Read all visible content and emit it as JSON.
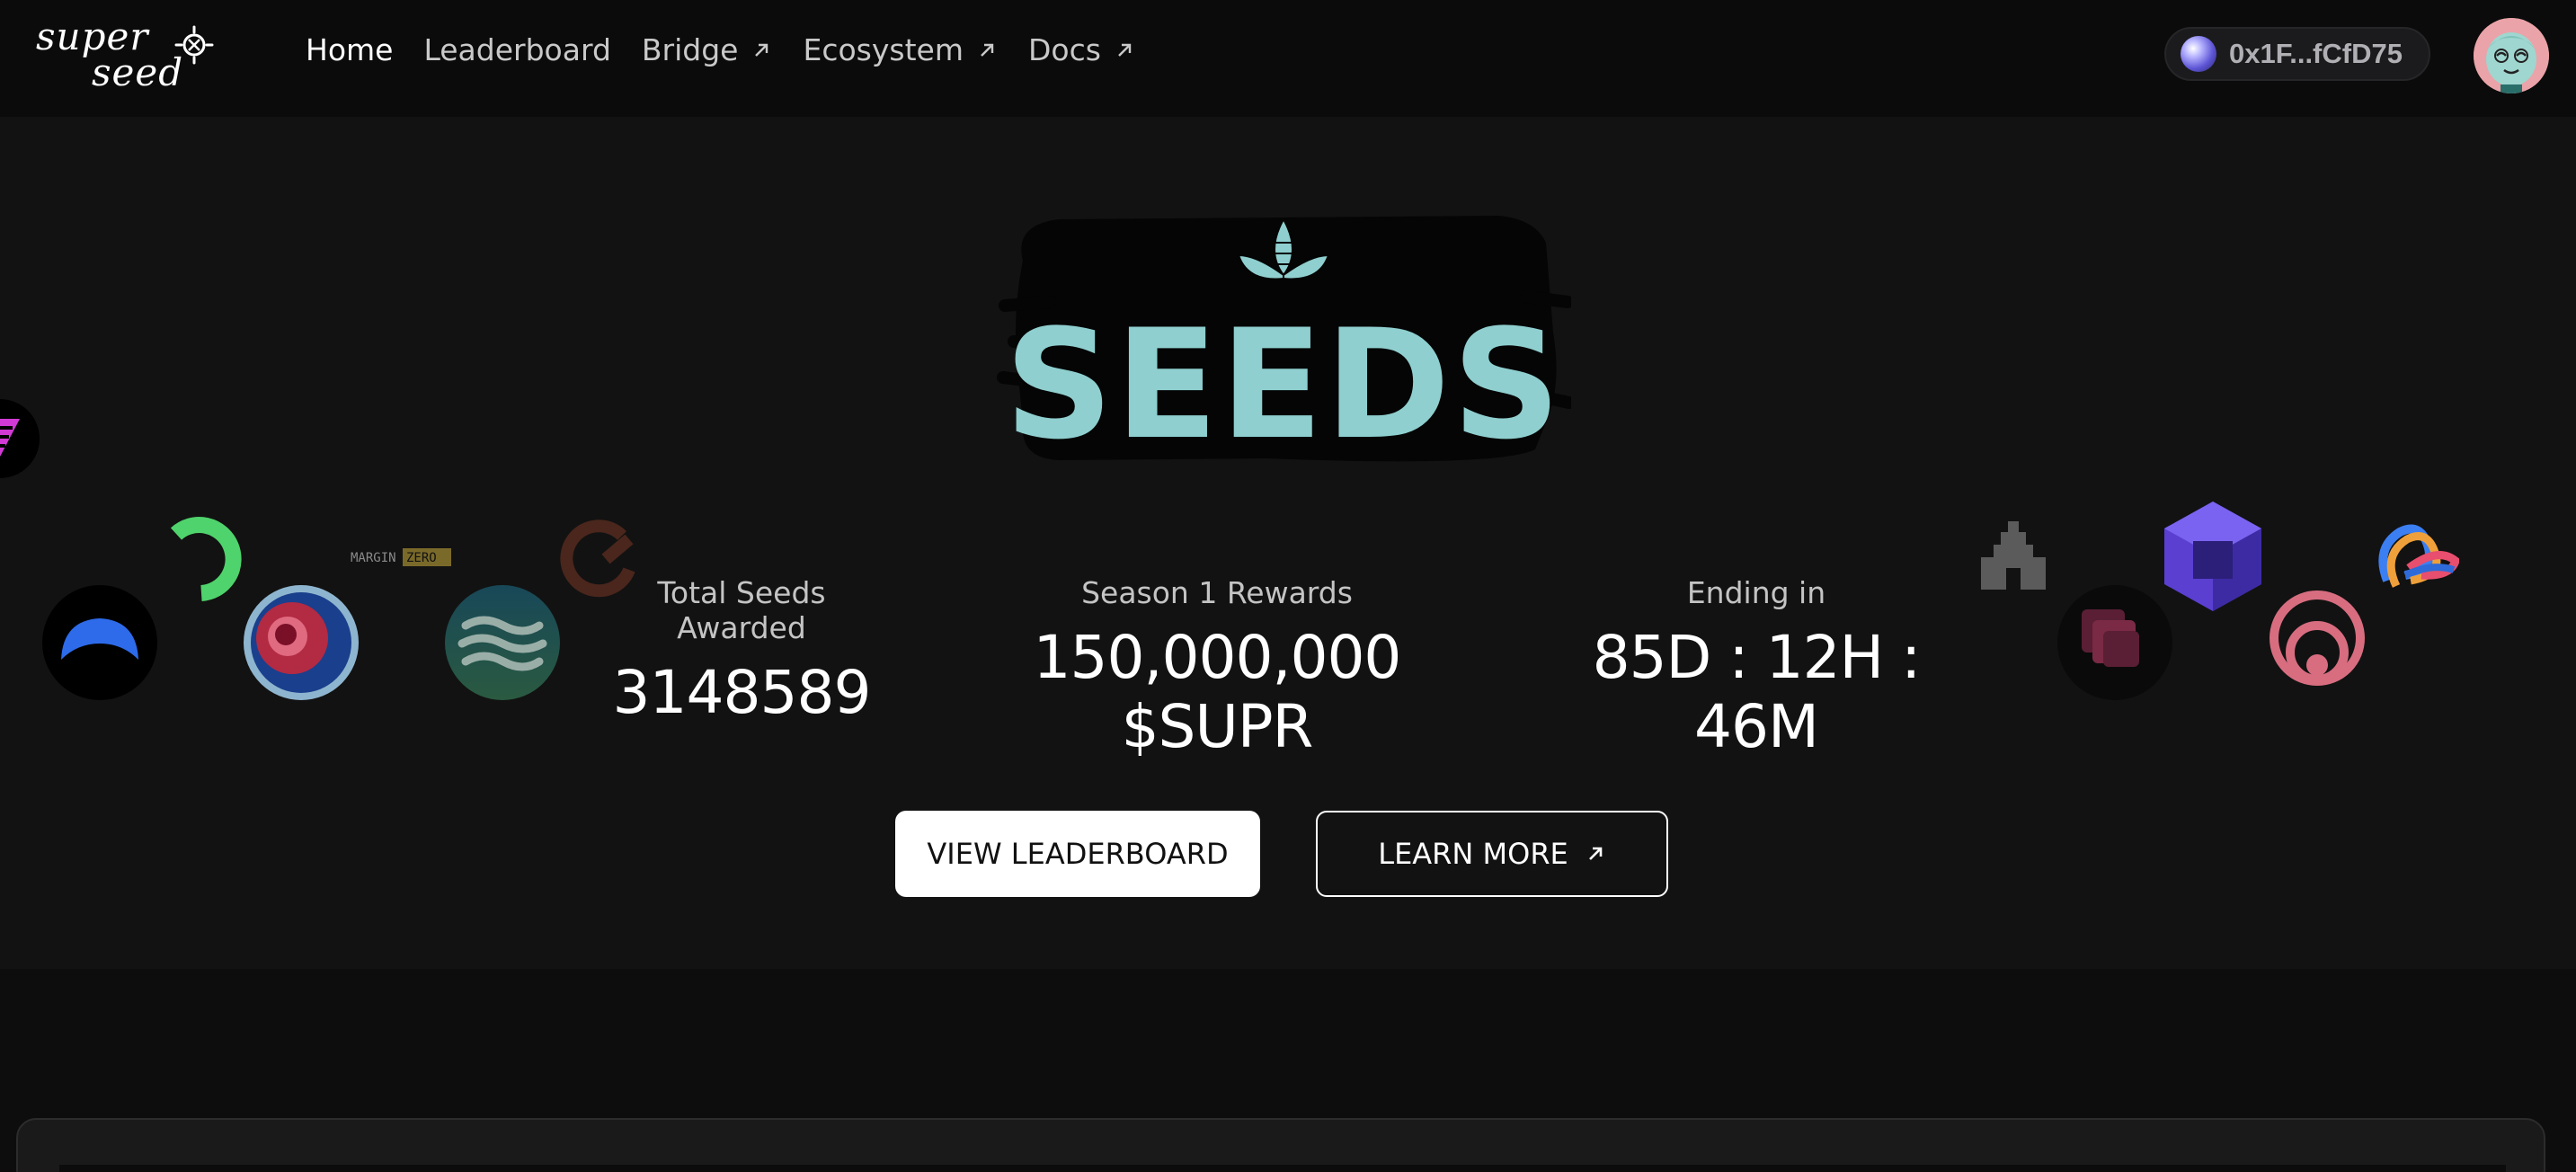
{
  "nav": {
    "logo_line1": "super",
    "logo_line2": "seed",
    "items": [
      {
        "label": "Home",
        "external": false,
        "active": true
      },
      {
        "label": "Leaderboard",
        "external": false,
        "active": false
      },
      {
        "label": "Bridge",
        "external": true,
        "active": false
      },
      {
        "label": "Ecosystem",
        "external": true,
        "active": false
      },
      {
        "label": "Docs",
        "external": true,
        "active": false
      }
    ],
    "wallet_address": "0x1F...fCfD75"
  },
  "hero": {
    "title": "SEEDS",
    "stats": [
      {
        "label": "Total Seeds Awarded",
        "value": "3148589"
      },
      {
        "label": "Season 1 Rewards",
        "value": "150,000,000 $SUPR"
      },
      {
        "label": "Ending in",
        "value": "85D : 12H : 46M"
      }
    ],
    "buttons": {
      "primary": "VIEW LEADERBOARD",
      "secondary": "LEARN MORE"
    },
    "partner_badge": "MARGIN ZERO"
  },
  "colors": {
    "background": "#0d0d0d",
    "hero_bg": "#121212",
    "seeds_teal": "#8fcfcf",
    "primary_button": "#ffffff"
  }
}
